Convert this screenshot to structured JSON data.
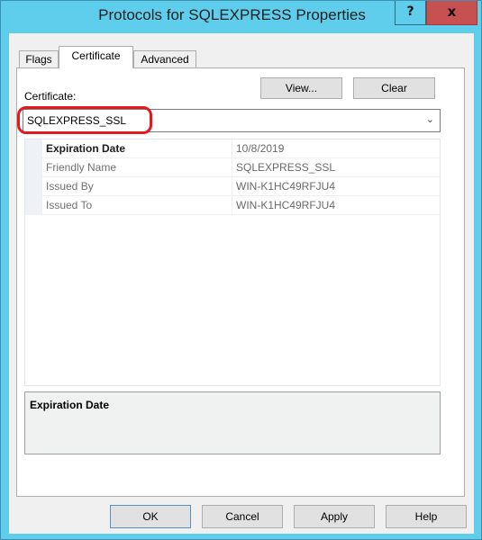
{
  "window": {
    "title": "Protocols for SQLEXPRESS Properties",
    "help_glyph": "?",
    "close_glyph": "x",
    "accent_color": "#5fcdec",
    "close_color": "#c75050"
  },
  "tabs": [
    {
      "label": "Flags",
      "active": false
    },
    {
      "label": "Certificate",
      "active": true
    },
    {
      "label": "Advanced",
      "active": false
    }
  ],
  "certificate": {
    "label": "Certificate:",
    "view_button": "View...",
    "clear_button": "Clear",
    "selected": "SQLEXPRESS_SSL",
    "dropdown_glyph": "⌄",
    "highlight_color": "#e3191e"
  },
  "properties": [
    {
      "name": "Expiration Date",
      "value": "10/8/2019",
      "selected": true
    },
    {
      "name": "Friendly Name",
      "value": "SQLEXPRESS_SSL",
      "selected": false
    },
    {
      "name": "Issued By",
      "value": "WIN-K1HC49RFJU4",
      "selected": false
    },
    {
      "name": "Issued To",
      "value": "WIN-K1HC49RFJU4",
      "selected": false
    }
  ],
  "description": {
    "title": "Expiration Date"
  },
  "footer": {
    "ok": "OK",
    "cancel": "Cancel",
    "apply": "Apply",
    "help": "Help"
  }
}
